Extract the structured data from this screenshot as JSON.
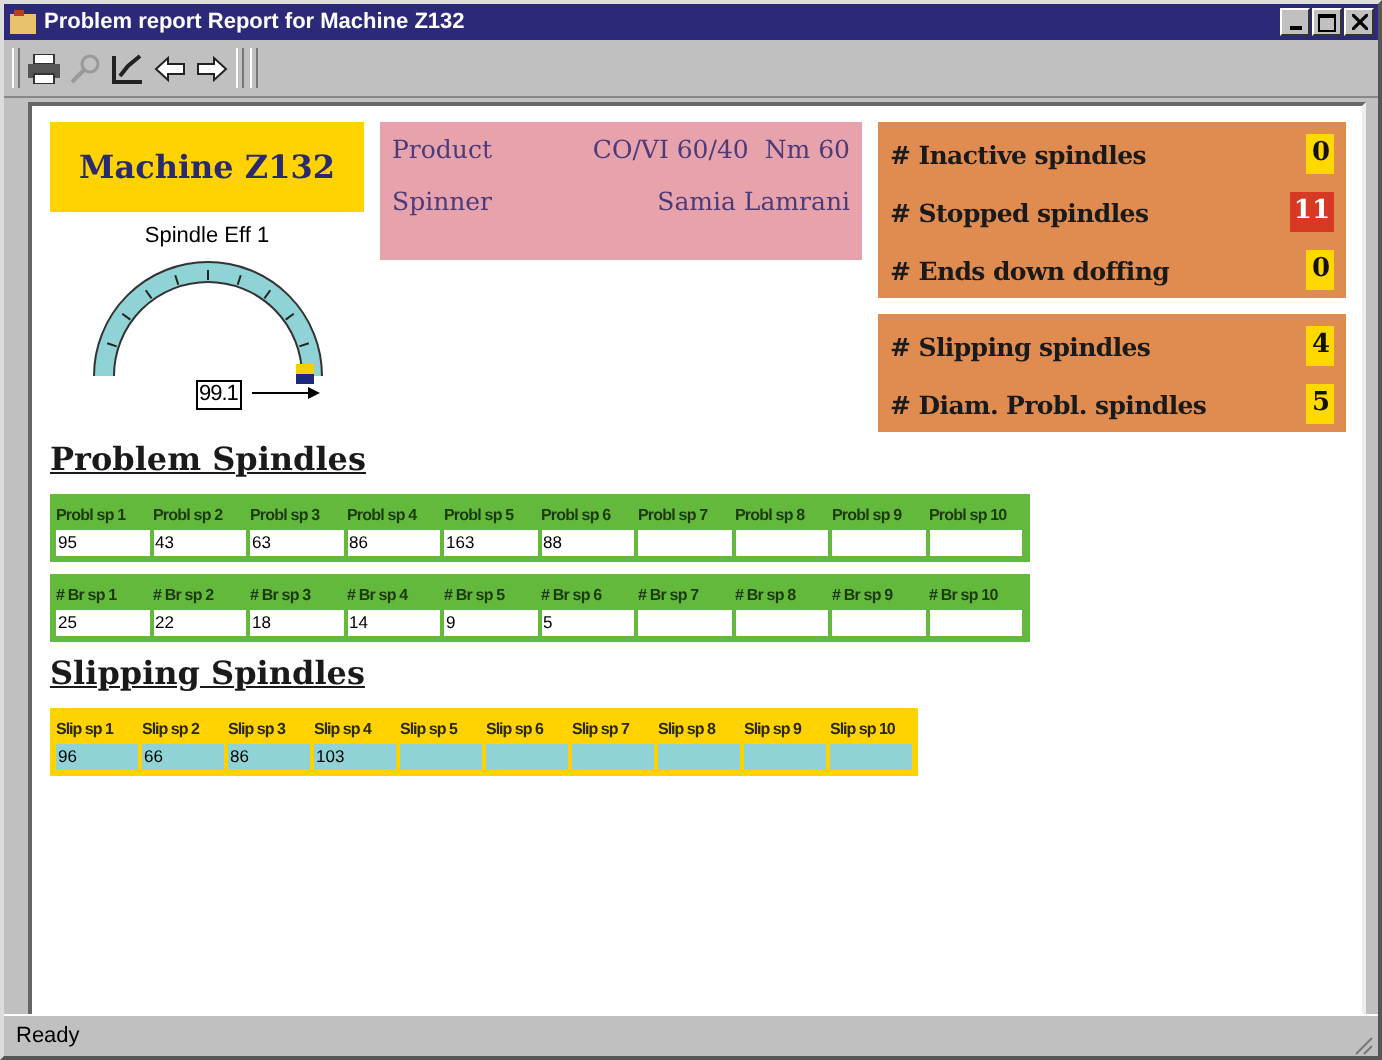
{
  "window": {
    "title": "Problem report Report for Machine Z132"
  },
  "machine": {
    "title": "Machine Z132"
  },
  "gauge": {
    "title": "Spindle Eff 1",
    "reading": "99.1"
  },
  "info": [
    {
      "label": "Product",
      "value": "CO/VI 60/40  Nm 60"
    },
    {
      "label": "Spinner",
      "value": "Samia Lamrani"
    }
  ],
  "counter_groups": [
    [
      {
        "label": "# Inactive spindles",
        "value": "0",
        "color": "#ffd800"
      },
      {
        "label": "# Stopped spindles",
        "value": "11",
        "color": "#d63a22"
      },
      {
        "label": "# Ends down doffing",
        "value": "0",
        "color": "#ffd800"
      }
    ],
    [
      {
        "label": "# Slipping spindles",
        "value": "4",
        "color": "#ffd800"
      },
      {
        "label": "# Diam. Probl. spindles",
        "value": "5",
        "color": "#ffd800"
      }
    ]
  ],
  "sections": [
    {
      "title": "Problem Spindles",
      "kind": "green",
      "tables": [
        {
          "columns": [
            "Probl sp 1",
            "Probl sp 2",
            "Probl sp 3",
            "Probl sp 4",
            "Probl sp 5",
            "Probl sp 6",
            "Probl sp 7",
            "Probl sp 8",
            "Probl sp 9",
            "Probl sp 10"
          ],
          "values": [
            "95",
            "43",
            "63",
            "86",
            "163",
            "88"
          ]
        },
        {
          "columns": [
            "#  Br sp 1",
            "#  Br sp 2",
            "#  Br sp 3",
            "#  Br sp 4",
            "#  Br sp 5",
            "#  Br sp 6",
            "#  Br sp 7",
            "#  Br sp 8",
            "#  Br sp 9",
            "#  Br sp 10"
          ],
          "values": [
            "25",
            "22",
            "18",
            "14",
            "9",
            "5"
          ]
        }
      ]
    },
    {
      "title": "Slipping Spindles",
      "kind": "yellow",
      "tables": [
        {
          "columns": [
            "Slip sp 1",
            "Slip sp 2",
            "Slip sp 3",
            "Slip sp 4",
            "Slip sp 5",
            "Slip sp 6",
            "Slip sp 7",
            "Slip sp 8",
            "Slip sp 9",
            "Slip sp 10"
          ],
          "values": [
            "96",
            "66",
            "86",
            "103"
          ]
        }
      ]
    }
  ],
  "status_bar": {
    "text": "Ready"
  }
}
